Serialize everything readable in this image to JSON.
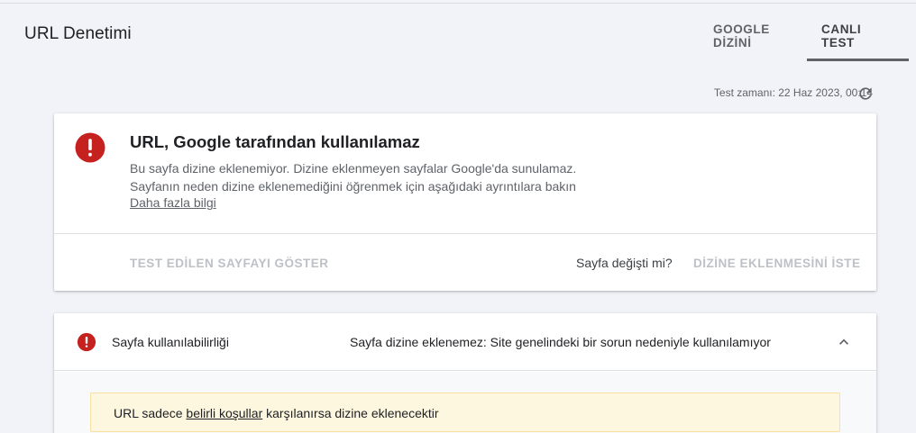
{
  "header": {
    "title": "URL Denetimi"
  },
  "tabs": [
    {
      "label": "GOOGLE DİZİNİ",
      "active": false
    },
    {
      "label": "CANLI TEST",
      "active": true
    }
  ],
  "test_time": "Test zamanı: 22 Haz 2023, 00:14",
  "status_card": {
    "title": "URL, Google tarafından kullanılamaz",
    "line1": "Bu sayfa dizine eklenemiyor. Dizine eklenmeyen sayfalar Google'da sunulamaz.",
    "line2": "Sayfanın neden dizine eklenemediğini öğrenmek için aşağıdaki ayrıntılara bakın",
    "link": "Daha fazla bilgi",
    "show_tested_button": "TEST EDİLEN SAYFAYI GÖSTER",
    "page_changed_question": "Sayfa değişti mi?",
    "request_indexing_button": "DİZİNE EKLENMESİNİ İSTE"
  },
  "availability": {
    "label": "Sayfa kullanılabilirliği",
    "status": "Sayfa dizine eklenemez: Site genelindeki bir sorun nedeniyle kullanılamıyor",
    "notice_pre": "URL sadece ",
    "notice_link": "belirli koşullar",
    "notice_post": " karşılanırsa dizine eklenecektir"
  },
  "colors": {
    "error": "#c5221f",
    "notice_bg": "#fef7e0",
    "disabled_text": "#bdc1c6"
  },
  "icons": [
    "error-icon",
    "refresh-icon",
    "chevron-up-icon"
  ]
}
